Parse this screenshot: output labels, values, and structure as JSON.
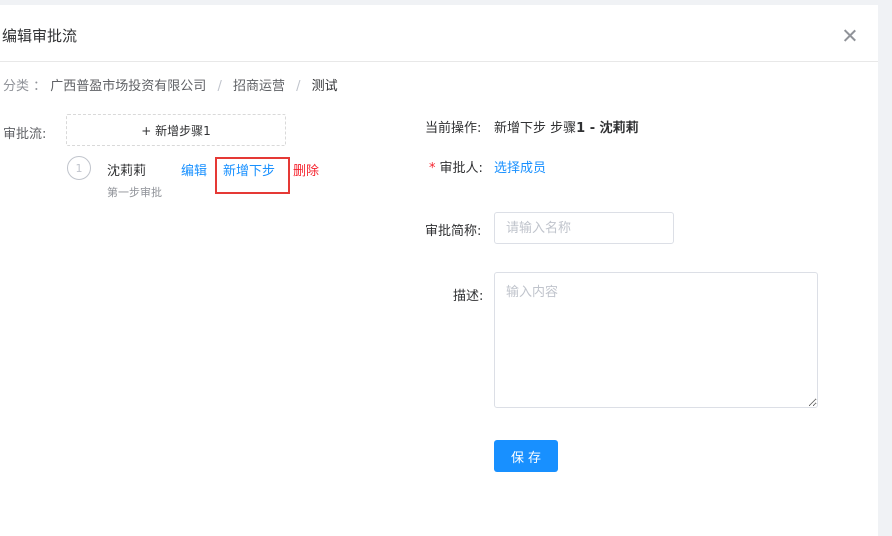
{
  "modal": {
    "title": "编辑审批流",
    "close_icon": "close-icon"
  },
  "breadcrumb": {
    "label": "分类 ：",
    "items": [
      "广西普盈市场投资有限公司",
      "招商运营",
      "测试"
    ],
    "separator": "/"
  },
  "flow": {
    "label": "审批流:",
    "add_step_label": "+ 新增步骤1",
    "steps": [
      {
        "number": "1",
        "name": "沈莉莉",
        "description": "第一步审批",
        "actions": {
          "edit": "编辑",
          "add_next": "新增下步",
          "delete": "删除"
        }
      }
    ]
  },
  "form": {
    "current_op_label": "当前操作:",
    "current_op_prefix": "新增下步 步骤",
    "current_op_bold": "1 - 沈莉莉",
    "approver_label": "审批人:",
    "approver_required": "*",
    "approver_action": "选择成员",
    "short_name_label": "审批简称:",
    "short_name_placeholder": "请输入名称",
    "short_name_value": "",
    "description_label": "描述:",
    "description_placeholder": "输入内容",
    "description_value": "",
    "save_label": "保存"
  },
  "colors": {
    "primary": "#1890ff",
    "danger": "#f5222d",
    "highlight": "#e53935"
  }
}
